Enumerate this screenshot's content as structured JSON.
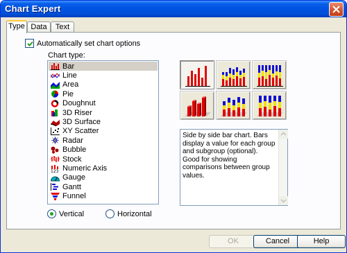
{
  "window": {
    "title": "Chart Expert"
  },
  "tabs": [
    {
      "label": "Type"
    },
    {
      "label": "Data"
    },
    {
      "label": "Text"
    }
  ],
  "auto_options": {
    "label": "Automatically set chart options",
    "checked": true
  },
  "chart_type": {
    "label": "Chart type:",
    "items": [
      {
        "label": "Bar",
        "icon": "bar-chart-icon",
        "selected": true
      },
      {
        "label": "Line",
        "icon": "line-chart-icon"
      },
      {
        "label": "Area",
        "icon": "area-chart-icon"
      },
      {
        "label": "Pie",
        "icon": "pie-chart-icon"
      },
      {
        "label": "Doughnut",
        "icon": "doughnut-chart-icon"
      },
      {
        "label": "3D Riser",
        "icon": "3d-riser-icon"
      },
      {
        "label": "3D Surface",
        "icon": "3d-surface-icon"
      },
      {
        "label": "XY Scatter",
        "icon": "xy-scatter-icon"
      },
      {
        "label": "Radar",
        "icon": "radar-chart-icon"
      },
      {
        "label": "Bubble",
        "icon": "bubble-chart-icon"
      },
      {
        "label": "Stock",
        "icon": "stock-chart-icon"
      },
      {
        "label": "Numeric Axis",
        "icon": "numeric-axis-icon"
      },
      {
        "label": "Gauge",
        "icon": "gauge-icon"
      },
      {
        "label": "Gantt",
        "icon": "gantt-chart-icon"
      },
      {
        "label": "Funnel",
        "icon": "funnel-chart-icon"
      }
    ]
  },
  "orientation": {
    "vertical": {
      "label": "Vertical",
      "selected": true
    },
    "horizontal": {
      "label": "Horizontal",
      "selected": false
    }
  },
  "subtypes": [
    {
      "name": "side-by-side-bar",
      "selected": true
    },
    {
      "name": "stacked-bar",
      "selected": false
    },
    {
      "name": "percent-bar",
      "selected": false
    },
    {
      "name": "3d-side-by-side-bar",
      "selected": false
    },
    {
      "name": "3d-stacked-bar",
      "selected": false
    },
    {
      "name": "3d-percent-bar",
      "selected": false
    }
  ],
  "description": "Side by side bar chart. Bars display a value for each group and subgroup (optional). Good for showing comparisons between group values.",
  "buttons": {
    "ok": "OK",
    "cancel": "Cancel",
    "help": "Help"
  },
  "colors": {
    "bar_red": "#e00000",
    "bar_blue": "#1010d0",
    "bar_yellow": "#f4e000",
    "title_blue": "#0054e3"
  }
}
